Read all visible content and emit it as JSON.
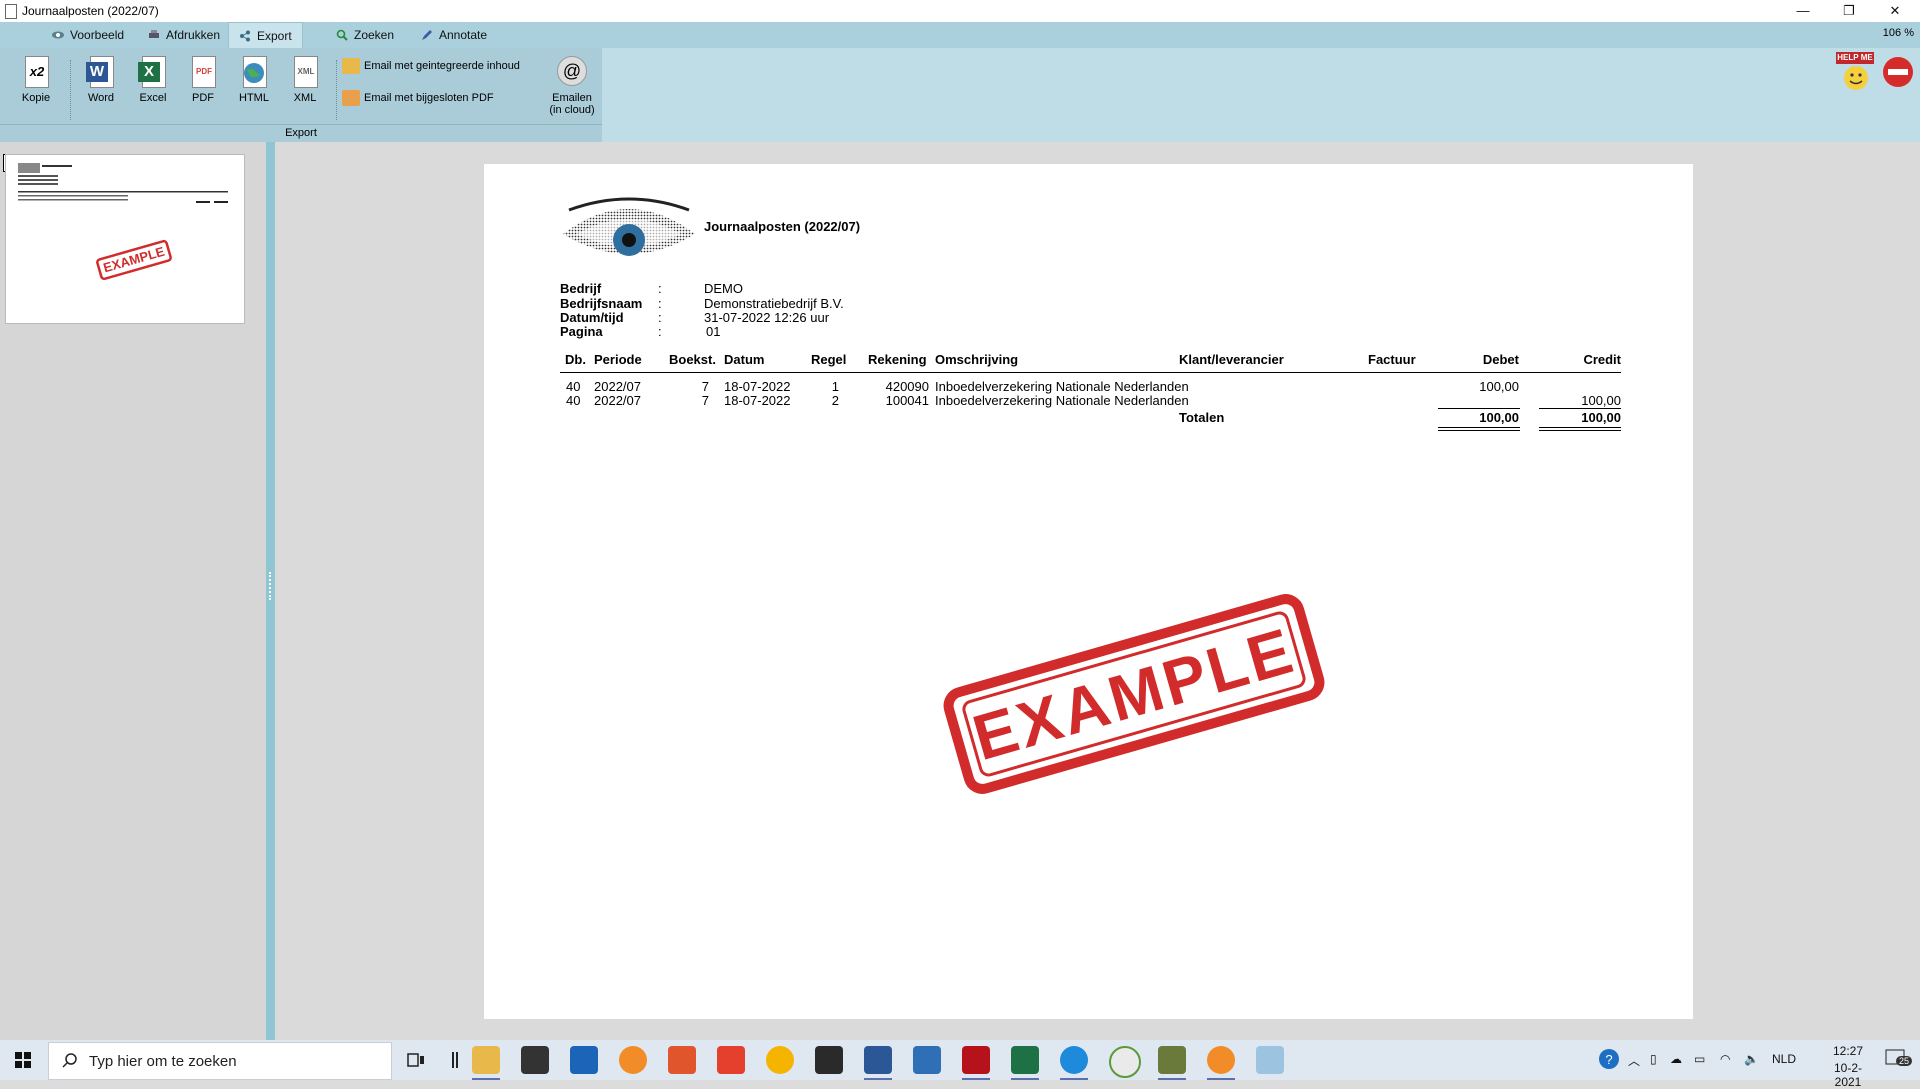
{
  "window": {
    "title": "Journaalposten (2022/07)",
    "minimize": "—",
    "restore": "❐",
    "close": "✕"
  },
  "tabs": [
    {
      "label": "Voorbeeld",
      "icon": "eye-icon"
    },
    {
      "label": "Afdrukken",
      "icon": "printer-icon"
    },
    {
      "label": "Export",
      "icon": "share-icon",
      "active": true
    },
    {
      "label": "Zoeken",
      "icon": "search-icon"
    },
    {
      "label": "Annotate",
      "icon": "pen-icon"
    }
  ],
  "zoom": "106 %",
  "ribbon": {
    "group_label": "Export",
    "buttons": [
      {
        "label": "Kopie",
        "badge": "x2"
      },
      {
        "label": "Word",
        "badge": "W",
        "color": "#2b5797"
      },
      {
        "label": "Excel",
        "badge": "X",
        "color": "#1e7145"
      },
      {
        "label": "PDF",
        "badge": "PDF",
        "color": "#d9403a"
      },
      {
        "label": "HTML",
        "badge": "🌐",
        "color": "#3c8dbc"
      },
      {
        "label": "XML",
        "badge": "XML",
        "color": "#666666"
      }
    ],
    "email_items": [
      {
        "label": "Email met geintegreerde inhoud"
      },
      {
        "label": "Email met bijgesloten PDF"
      }
    ],
    "cloud": {
      "label1": "Emailen",
      "label2": "(in cloud)"
    },
    "help_label": "HELP ME"
  },
  "thumbnail": {
    "page_number": "1",
    "stamp": "EXAMPLE"
  },
  "report": {
    "title": "Journaalposten (2022/07)",
    "info": [
      {
        "label": "Bedrijf",
        "sep": ":",
        "value": "DEMO"
      },
      {
        "label": "Bedrijfsnaam",
        "sep": ":",
        "value": "Demonstratiebedrijf B.V."
      },
      {
        "label": "Datum/tijd",
        "sep": ":",
        "value": "31-07-2022  12:26 uur"
      },
      {
        "label": "Pagina",
        "sep": ":",
        "value": "01"
      }
    ],
    "columns": [
      "Db.",
      "Periode",
      "Boekst.",
      "Datum",
      "Regel",
      "Rekening",
      "Omschrijving",
      "Klant/leverancier",
      "Factuur",
      "Debet",
      "Credit"
    ],
    "rows": [
      {
        "db": "40",
        "periode": "2022/07",
        "boekst": "7",
        "datum": "18-07-2022",
        "regel": "1",
        "rekening": "420090",
        "omschrijving": "Inboedelverzekering Nationale Nederlanden",
        "debet": "100,00",
        "credit": ""
      },
      {
        "db": "40",
        "periode": "2022/07",
        "boekst": "7",
        "datum": "18-07-2022",
        "regel": "2",
        "rekening": "100041",
        "omschrijving": "Inboedelverzekering Nationale Nederlanden",
        "debet": "",
        "credit": "100,00"
      }
    ],
    "totals": {
      "label": "Totalen",
      "debet": "100,00",
      "credit": "100,00"
    },
    "stamp": "EXAMPLE"
  },
  "taskbar": {
    "search_placeholder": "Typ hier om te zoeken",
    "language": "NLD",
    "time": "12:27",
    "date": "10-2-2021",
    "notifications": "25"
  }
}
